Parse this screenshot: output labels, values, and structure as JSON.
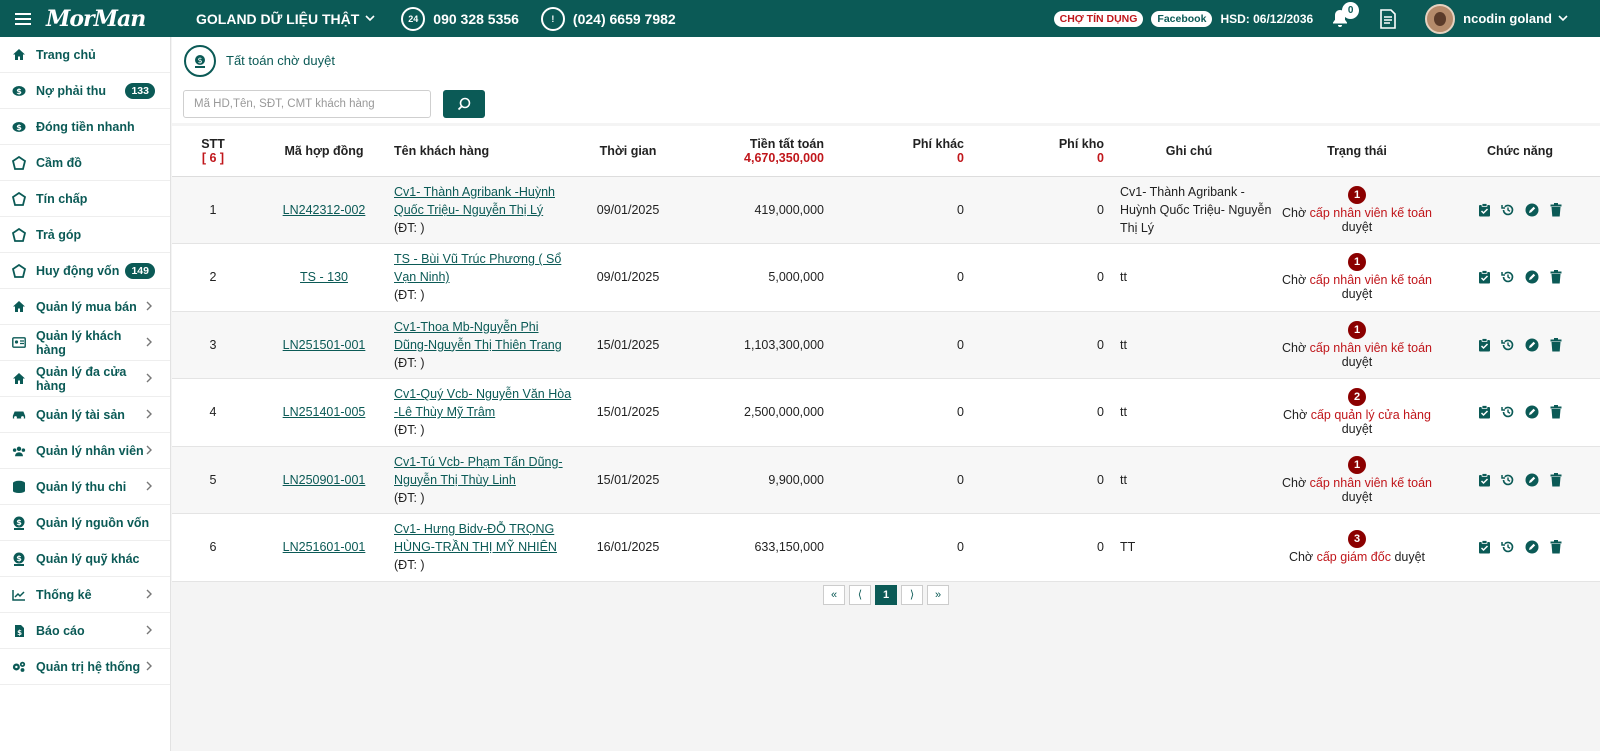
{
  "topbar": {
    "logo": "MorMan",
    "store": "GOLAND DỮ LIỆU THẬT",
    "phone1_badge": "24",
    "phone1": "090 328 5356",
    "phone2": "(024) 6659 7982",
    "pill_credit": "CHỢ TÍN DỤNG",
    "pill_facebook": "Facebook",
    "hsd": "HSD: 06/12/2036",
    "notif_count": "0",
    "username": "ncodin goland"
  },
  "sidebar": {
    "items": [
      {
        "label": "Trang chủ",
        "icon": "home-icon"
      },
      {
        "label": "Nợ phải thu",
        "icon": "money-icon",
        "count": "133"
      },
      {
        "label": "Đóng tiền nhanh",
        "icon": "money-icon"
      },
      {
        "label": "Cầm đồ",
        "icon": "pawn-icon"
      },
      {
        "label": "Tín chấp",
        "icon": "pawn-icon"
      },
      {
        "label": "Trả góp",
        "icon": "pawn-icon"
      },
      {
        "label": "Huy động vốn",
        "icon": "pawn-icon",
        "count": "149"
      },
      {
        "label": "Quản lý mua bán",
        "icon": "home-icon",
        "submenu": true
      },
      {
        "label": "Quản lý khách hàng",
        "icon": "id-card-icon",
        "submenu": true
      },
      {
        "label": "Quản lý đa cửa hàng",
        "icon": "home-icon",
        "submenu": true
      },
      {
        "label": "Quản lý tài sản",
        "icon": "car-icon",
        "submenu": true
      },
      {
        "label": "Quản lý nhân viên",
        "icon": "users-icon",
        "submenu": true
      },
      {
        "label": "Quản lý thu chi",
        "icon": "coins-icon",
        "submenu": true
      },
      {
        "label": "Quản lý nguồn vốn",
        "icon": "money-hand-icon"
      },
      {
        "label": "Quản lý quỹ khác",
        "icon": "money-hand-icon"
      },
      {
        "label": "Thống kê",
        "icon": "chart-icon",
        "submenu": true
      },
      {
        "label": "Báo cáo",
        "icon": "report-icon",
        "submenu": true
      },
      {
        "label": "Quản trị hệ thống",
        "icon": "gears-icon",
        "submenu": true
      }
    ]
  },
  "page": {
    "title": "Tất toán chờ duyệt",
    "search_placeholder": "Mã HD,Tên, SĐT, CMT khách hàng"
  },
  "table": {
    "headers": {
      "stt": "STT",
      "stt_sub": "[ 6 ]",
      "contract": "Mã hợp đồng",
      "customer": "Tên khách hàng",
      "time": "Thời gian",
      "amount": "Tiền tất toán",
      "amount_sub": "4,670,350,000",
      "other_fee": "Phí khác",
      "other_fee_sub": "0",
      "storage_fee": "Phí kho",
      "storage_fee_sub": "0",
      "note": "Ghi chú",
      "status": "Trạng thái",
      "actions": "Chức năng"
    },
    "rows": [
      {
        "stt": "1",
        "contract": "LN242312-002",
        "customer": "Cv1- Thành Agribank -Huỳnh Quốc Triệu- Nguyễn Thị Lý",
        "phone": "(ĐT: )",
        "time": "09/01/2025",
        "amount": "419,000,000",
        "other_fee": "0",
        "storage_fee": "0",
        "note": "Cv1- Thành Agribank -Huỳnh Quốc Triệu- Nguyễn Thị Lý",
        "level": "1",
        "wait": "Chờ",
        "role": "cấp nhân viên kế toán",
        "approve": "duyệt"
      },
      {
        "stt": "2",
        "contract": "TS - 130",
        "customer": "TS - Bùi Vũ Trúc Phương ( Sổ Vạn Ninh)",
        "phone": "(ĐT: )",
        "time": "09/01/2025",
        "amount": "5,000,000",
        "other_fee": "0",
        "storage_fee": "0",
        "note": "tt",
        "level": "1",
        "wait": "Chờ",
        "role": "cấp nhân viên kế toán",
        "approve": "duyệt"
      },
      {
        "stt": "3",
        "contract": "LN251501-001",
        "customer": "Cv1-Thoa Mb-Nguyễn Phi Dũng-Nguyễn Thị Thiên Trang",
        "phone": "(ĐT: )",
        "time": "15/01/2025",
        "amount": "1,103,300,000",
        "other_fee": "0",
        "storage_fee": "0",
        "note": "tt",
        "level": "1",
        "wait": "Chờ",
        "role": "cấp nhân viên kế toán",
        "approve": "duyệt"
      },
      {
        "stt": "4",
        "contract": "LN251401-005",
        "customer": "Cv1-Quý Vcb- Nguyễn Văn Hòa -Lê Thùy Mỹ Trâm",
        "phone": "(ĐT: )",
        "time": "15/01/2025",
        "amount": "2,500,000,000",
        "other_fee": "0",
        "storage_fee": "0",
        "note": "tt",
        "level": "2",
        "wait": "Chờ",
        "role": "cấp quản lý cửa hàng",
        "approve": "duyệt"
      },
      {
        "stt": "5",
        "contract": "LN250901-001",
        "customer": "Cv1-Tú Vcb- Phạm Tấn Dũng-Nguyễn Thị Thùy Linh",
        "phone": "(ĐT: )",
        "time": "15/01/2025",
        "amount": "9,900,000",
        "other_fee": "0",
        "storage_fee": "0",
        "note": "tt",
        "level": "1",
        "wait": "Chờ",
        "role": "cấp nhân viên kế toán",
        "approve": "duyệt"
      },
      {
        "stt": "6",
        "contract": "LN251601-001",
        "customer": "Cv1- Hưng Bidv-ĐỖ TRỌNG HÙNG-TRẦN THỊ MỸ NHIÊN",
        "phone": "(ĐT: )",
        "time": "16/01/2025",
        "amount": "633,150,000",
        "other_fee": "0",
        "storage_fee": "0",
        "note": "TT",
        "level": "3",
        "wait": "Chờ",
        "role": "cấp giám đốc",
        "approve": "duyệt"
      }
    ]
  },
  "pager": {
    "first": "«",
    "prev": "⟨",
    "current": "1",
    "next": "⟩",
    "last": "»"
  },
  "colors": {
    "brand": "#0b5a56",
    "accent_red": "#c0161b",
    "level_badge": "#8b0000"
  }
}
